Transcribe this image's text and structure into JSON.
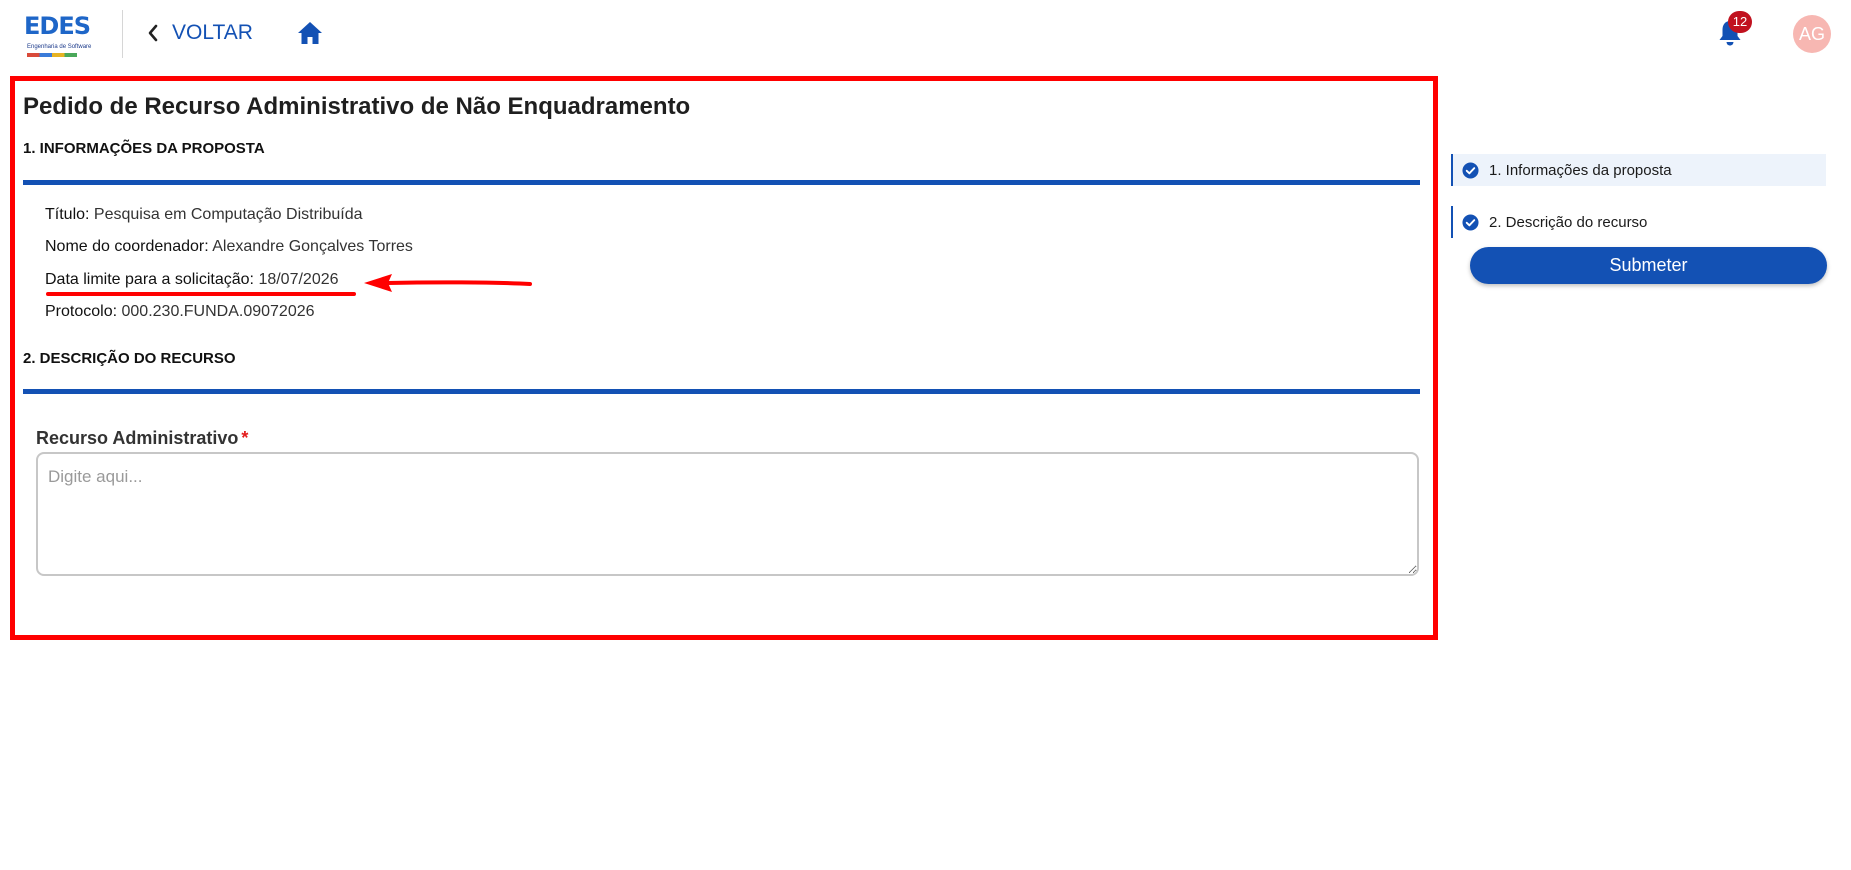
{
  "header": {
    "logo_text": "EDES",
    "logo_subtitle": "Engenharia de Software",
    "back_label": "VOLTAR",
    "notification_count": "12",
    "avatar_initials": "AG",
    "icons": [
      "chevron-left-icon",
      "home-icon",
      "bell-icon"
    ]
  },
  "page": {
    "title": "Pedido de Recurso Administrativo de Não Enquadramento"
  },
  "section1": {
    "heading": "1. INFORMAÇÕES DA PROPOSTA",
    "rows": [
      {
        "label": "Título:",
        "value": "Pesquisa em Computação Distribuída"
      },
      {
        "label": "Nome do coordenador:",
        "value": "Alexandre Gonçalves Torres"
      },
      {
        "label": "Data limite para a solicitação:",
        "value": "18/07/2026"
      },
      {
        "label": "Protocolo:",
        "value": "000.230.FUNDA.09072026"
      }
    ]
  },
  "section2": {
    "heading": "2. DESCRIÇÃO DO RECURSO",
    "field_label": "Recurso Administrativo",
    "required_mark": "*",
    "field_placeholder": "Digite aqui...",
    "field_value": ""
  },
  "stepper": {
    "steps": [
      {
        "label": "1. Informações da proposta",
        "active": true,
        "completed": true
      },
      {
        "label": "2. Descrição do recurso",
        "active": false,
        "completed": true
      }
    ],
    "submit_label": "Submeter"
  },
  "colors": {
    "primary": "#1351b4",
    "annotation_red": "#ff0000",
    "badge_red": "#c1121f",
    "avatar_bg": "#f7b7b2",
    "active_step_bg": "#edf3fb"
  }
}
